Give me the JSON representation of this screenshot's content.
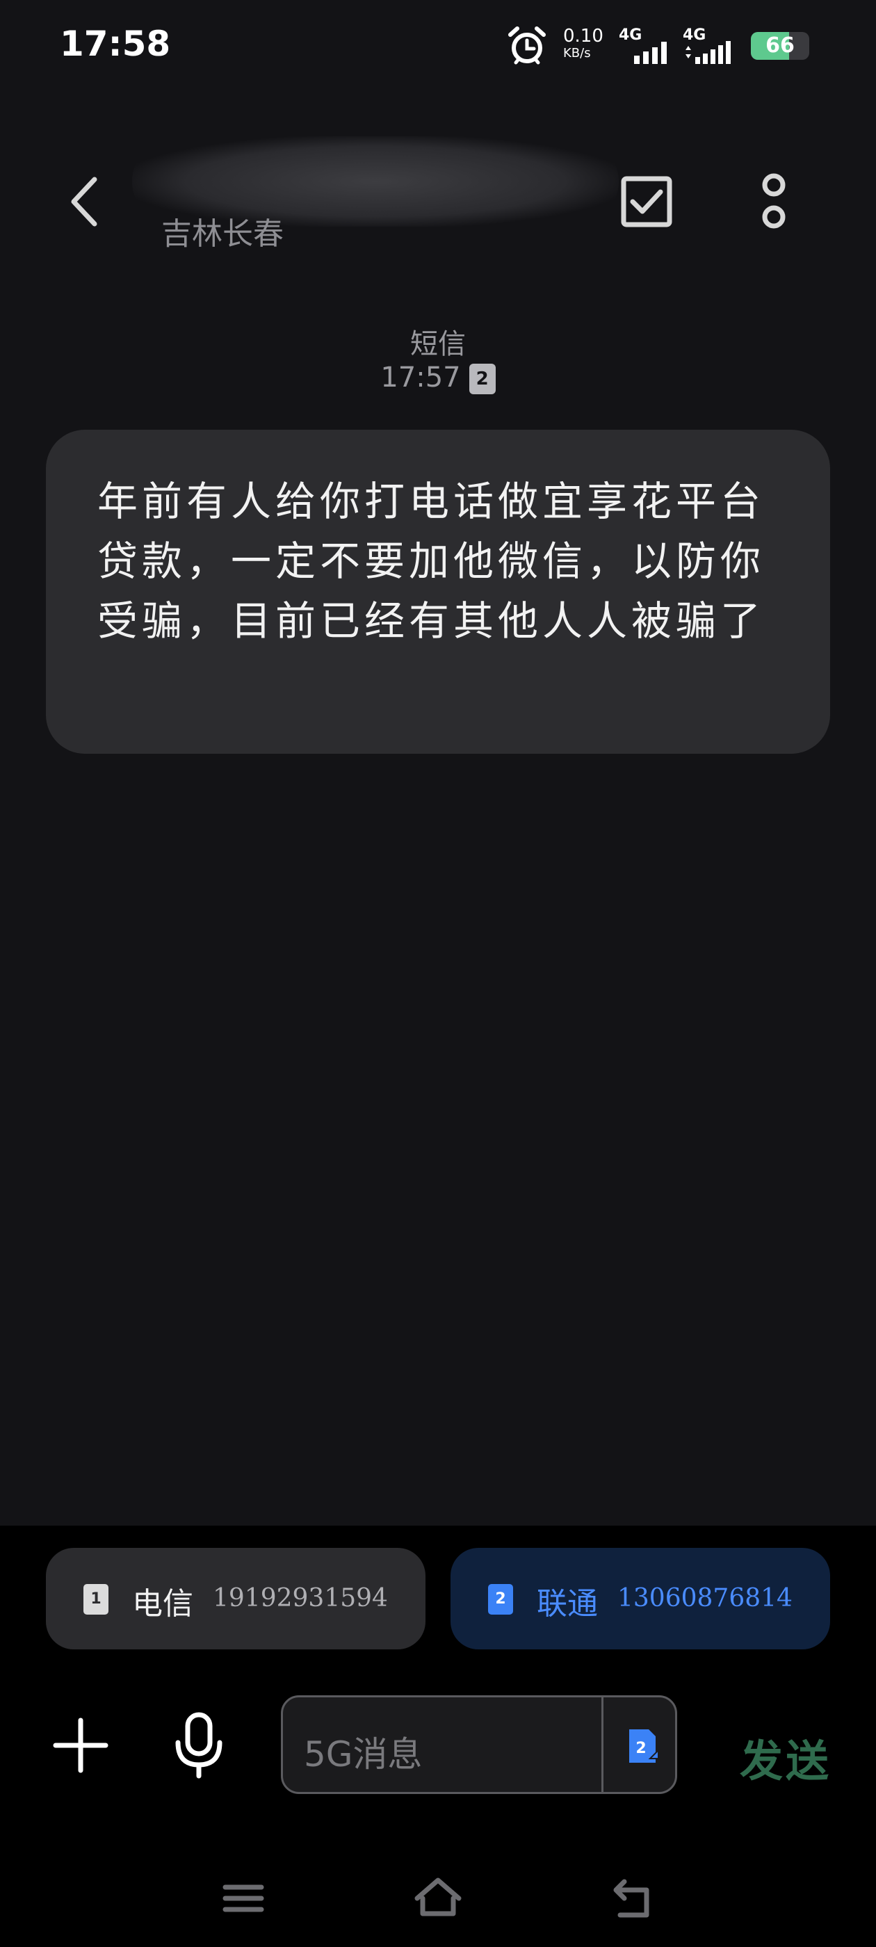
{
  "status_bar": {
    "time": "17:58",
    "net_speed_value": "0.10",
    "net_speed_unit": "KB/s",
    "sim1_network": "4G",
    "sim2_network": "4G",
    "battery": "66",
    "battery_level": 0.66,
    "icons": [
      "alarm-icon",
      "signal-icon",
      "signal-icon",
      "battery-icon"
    ]
  },
  "header": {
    "contact_location": "吉林长春",
    "icons": [
      "back-arrow-icon",
      "checkbox-icon",
      "more-vertical-icon"
    ]
  },
  "thread": {
    "type_label": "短信",
    "timestamp": "17:57",
    "sim_indicator": "2"
  },
  "message": {
    "text": "年前有人给你打电话做宜享花平台贷款，一定不要加他微信，以防你受骗，目前已经有其他人人被骗了"
  },
  "sim_selector": [
    {
      "slot": "1",
      "carrier": "电信",
      "number": "19192931594"
    },
    {
      "slot": "2",
      "carrier": "联通",
      "number": "13060876814"
    }
  ],
  "composer": {
    "placeholder": "5G消息",
    "sim_slot": "2",
    "send_label": "发送"
  },
  "colors": {
    "background": "#131316",
    "bubble": "#2c2c2f",
    "accent_blue": "#4a8cff",
    "send_green": "#2f6b4d"
  },
  "navbar": {
    "icons": [
      "menu-icon",
      "home-icon",
      "back-icon"
    ]
  }
}
